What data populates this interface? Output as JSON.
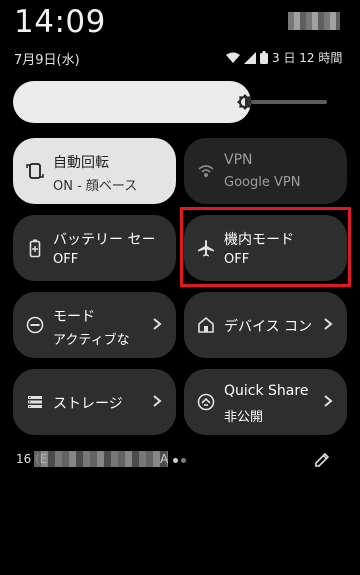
{
  "header": {
    "time": "14:09",
    "date": "7月9日(水)"
  },
  "status": {
    "battery_text": "3 日 12 時間"
  },
  "brightness": {
    "icon": "brightness-icon",
    "level": 0.72
  },
  "tiles": [
    {
      "title": "自動回転",
      "subtitle": "ON - 顔ベース",
      "icon": "auto-rotate-icon",
      "state": "on"
    },
    {
      "title": "VPN",
      "subtitle": "Google VPN",
      "icon": "vpn-icon",
      "state": "unavailable"
    },
    {
      "title": "バッテリー セー",
      "subtitle": "OFF",
      "icon": "battery-saver-icon",
      "state": "off"
    },
    {
      "title": "機内モード",
      "subtitle": "OFF",
      "icon": "airplane-icon",
      "state": "off"
    },
    {
      "title": "モード",
      "subtitle": "アクティブな",
      "icon": "mode-icon",
      "state": "off"
    },
    {
      "title": "デバイス コン",
      "subtitle": "",
      "icon": "home-icon",
      "state": "off"
    },
    {
      "title": "ストレージ",
      "subtitle": "",
      "icon": "storage-icon",
      "state": "off"
    },
    {
      "title": "Quick Share",
      "subtitle": "非公開",
      "icon": "quick-share-icon",
      "state": "off"
    }
  ],
  "footer": {
    "prefix": "16 (E",
    "suffix": "A"
  }
}
